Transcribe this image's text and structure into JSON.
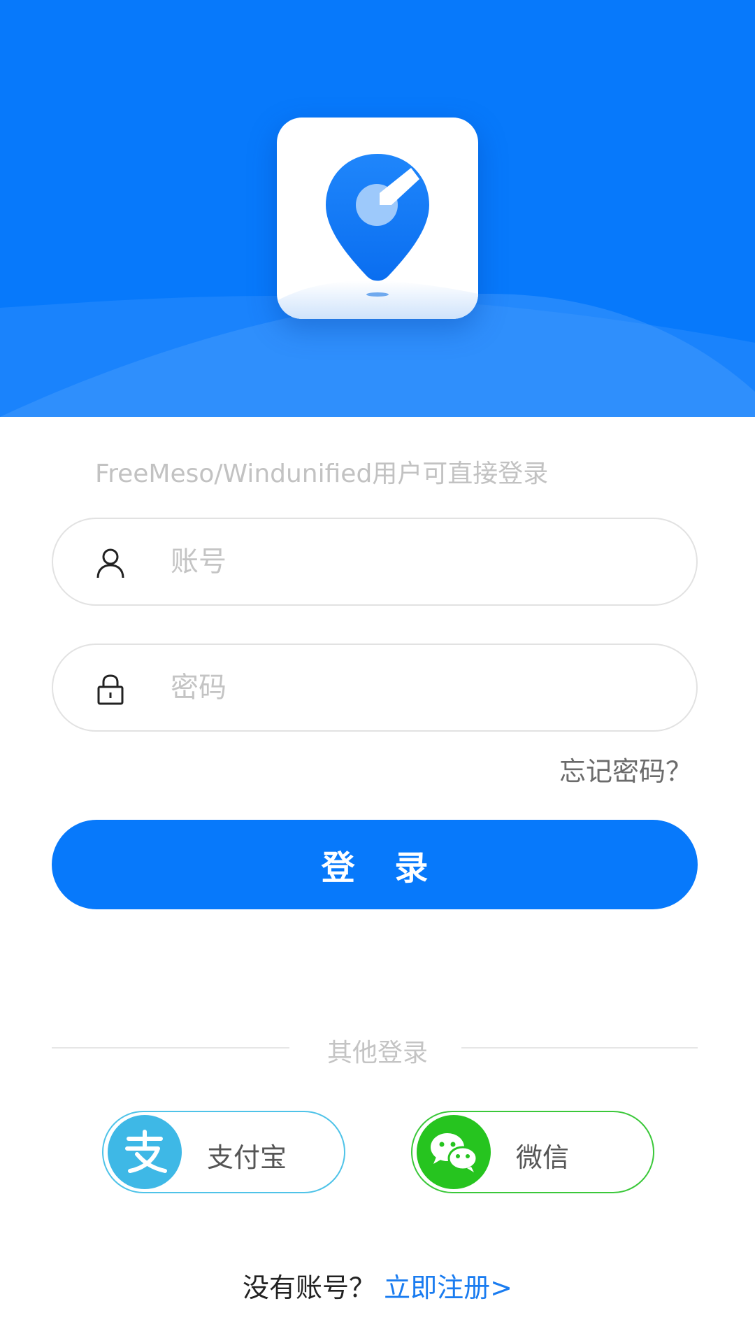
{
  "login_hint": "FreeMeso/Windunified用户可直接登录",
  "account_field": {
    "placeholder": "账号",
    "value": ""
  },
  "password_field": {
    "placeholder": "密码",
    "value": ""
  },
  "forgot_password": "忘记密码？",
  "login_button": "登 录",
  "other_login": "其他登录",
  "social_logins": {
    "alipay": {
      "label": "支付宝",
      "icon": "alipay-icon",
      "color": "#3eb8e6"
    },
    "wechat": {
      "label": "微信",
      "icon": "wechat-icon",
      "color": "#26c41f"
    }
  },
  "register": {
    "question": "没有账号？",
    "link": "立即注册>"
  },
  "colors": {
    "brand": "#0779fb",
    "link": "#1a7cf0"
  }
}
